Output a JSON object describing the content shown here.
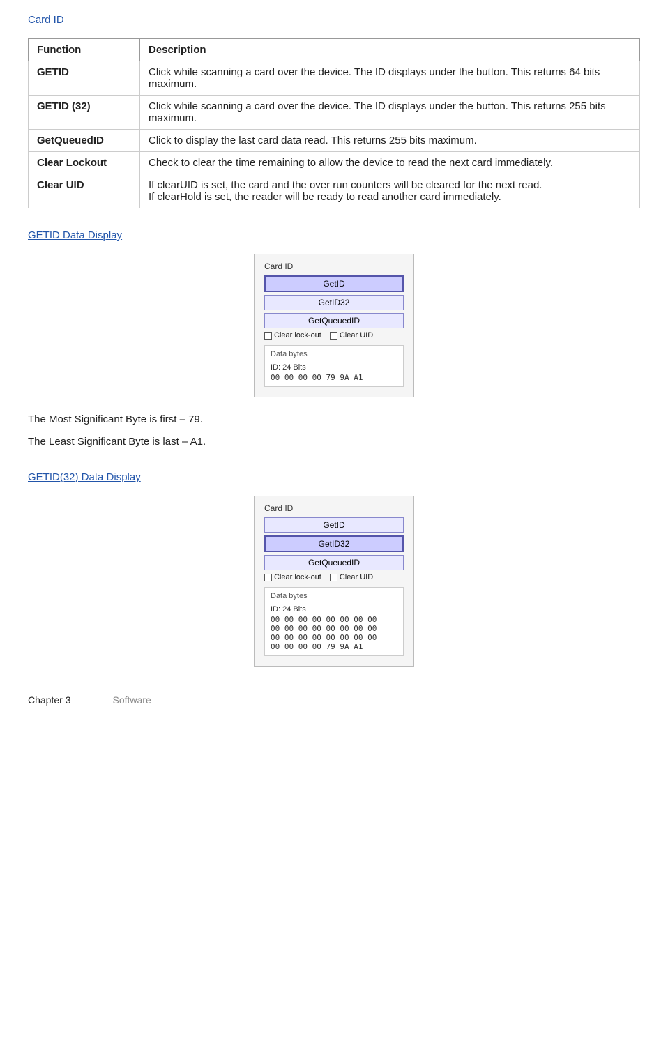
{
  "page": {
    "title": "Card ID",
    "table": {
      "col_function": "Function",
      "col_description": "Description",
      "rows": [
        {
          "func": "GETID",
          "desc": "Click while scanning a card over the device. The ID displays under the button. This returns 64 bits maximum."
        },
        {
          "func": "GETID (32)",
          "desc": "Click while scanning a card over the device. The ID displays under the button. This returns 255 bits maximum."
        },
        {
          "func": "GetQueuedID",
          "desc": "Click to display the last card data read. This returns 255 bits maximum."
        },
        {
          "func": "Clear Lockout",
          "desc": "Check to clear the time remaining to allow the device to read the next card immediately."
        },
        {
          "func": "Clear UID",
          "desc": "If clearUID is set, the card and the over run counters will be cleared for the next read.\nIf clearHold is set, the reader will be ready to read another card immediately."
        }
      ]
    },
    "sections": [
      {
        "id": "getid-display",
        "heading": "GETID Data Display",
        "mockup": {
          "card_title": "Card ID",
          "buttons": [
            {
              "label": "GetID",
              "active": true
            },
            {
              "label": "GetID32",
              "active": false
            },
            {
              "label": "GetQueuedID",
              "active": false
            }
          ],
          "checkboxes": [
            {
              "label": "Clear lock-out"
            },
            {
              "label": "Clear UID"
            }
          ],
          "data_section": {
            "label": "Data bytes",
            "bits_line": "ID: 24 Bits",
            "hex_line": "00 00 00 00 79 9A A1"
          }
        },
        "notes": [
          "The Most Significant Byte is first – 79.",
          "The Least Significant Byte is last – A1."
        ]
      },
      {
        "id": "getid32-display",
        "heading": "GETID(32) Data Display",
        "mockup": {
          "card_title": "Card ID",
          "buttons": [
            {
              "label": "GetID",
              "active": false
            },
            {
              "label": "GetID32",
              "active": true
            },
            {
              "label": "GetQueuedID",
              "active": false
            }
          ],
          "checkboxes": [
            {
              "label": "Clear lock-out"
            },
            {
              "label": "Clear UID"
            }
          ],
          "data_section": {
            "label": "Data bytes",
            "bits_line": "ID: 24 Bits",
            "hex_lines": [
              "00 00 00 00 00 00 00 00",
              "00 00 00 00 00 00 00 00",
              "00 00 00 00 00 00 00 00",
              "00 00 00 00 79 9A A1"
            ]
          }
        },
        "notes": []
      }
    ],
    "footer": {
      "chapter": "Chapter 3",
      "label": "Software"
    }
  }
}
